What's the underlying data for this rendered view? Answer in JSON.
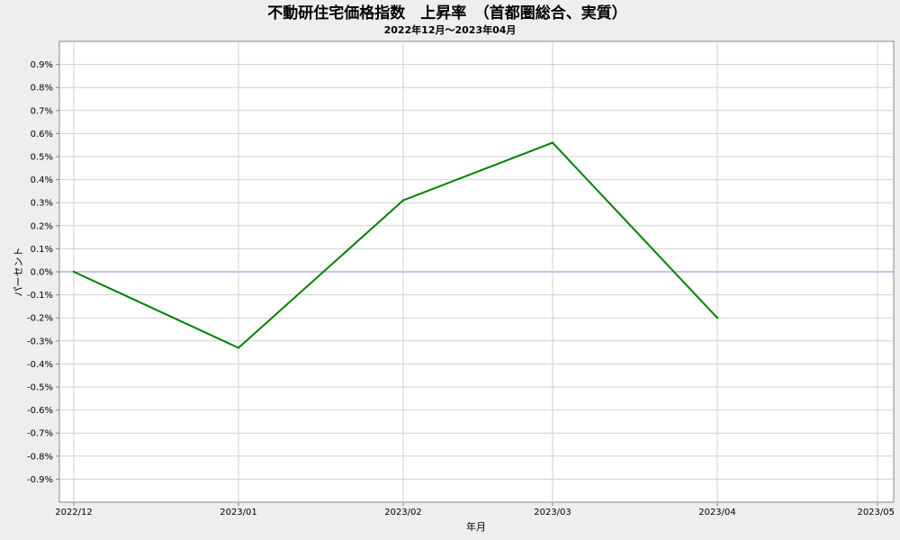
{
  "chart_data": {
    "type": "line",
    "title": "不動研住宅価格指数　上昇率　（首都圏総合、実質）",
    "subtitle": "2022年12月～2023年04月",
    "xlabel": "年月",
    "ylabel": "パーセント",
    "x_ticks": [
      "2022/12",
      "2023/01",
      "2023/02",
      "2023/03",
      "2023/04",
      "2023/05"
    ],
    "y_ticks": [
      "0.9%",
      "0.8%",
      "0.7%",
      "0.6%",
      "0.5%",
      "0.4%",
      "0.3%",
      "0.2%",
      "0.1%",
      "0.0%",
      "-0.1%",
      "-0.2%",
      "-0.3%",
      "-0.4%",
      "-0.5%",
      "-0.6%",
      "-0.7%",
      "-0.8%",
      "-0.9%"
    ],
    "ylim": [
      -0.9,
      0.9
    ],
    "grid": true,
    "series": [
      {
        "x": [
          "2022/12",
          "2023/01",
          "2023/02",
          "2023/03",
          "2023/04"
        ],
        "values": [
          0.0,
          -0.33,
          0.31,
          0.56,
          -0.2
        ],
        "color": "#008000"
      }
    ],
    "zero_line_color": "#8888cc"
  }
}
